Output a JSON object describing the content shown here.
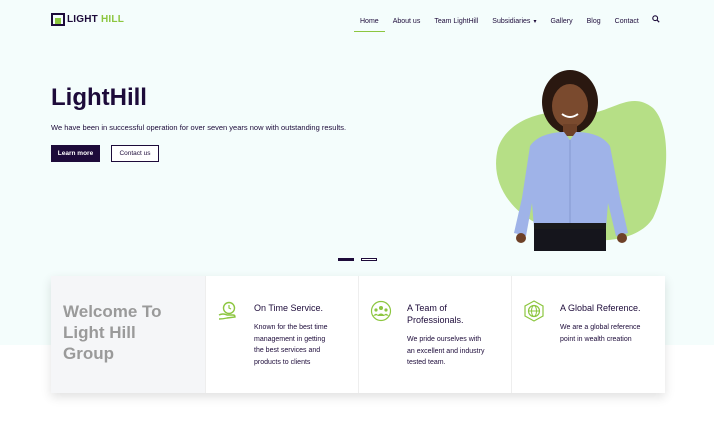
{
  "brand": {
    "logo_light": "LIGHT",
    "logo_hill": "HILL",
    "accent_green": "#8cc63f",
    "brand_navy": "#1d0b3a"
  },
  "nav": {
    "items": [
      {
        "label": "Home",
        "active": true
      },
      {
        "label": "About us"
      },
      {
        "label": "Team LightHill"
      },
      {
        "label": "Subsidiaries",
        "caret": "▾"
      },
      {
        "label": "Gallery"
      },
      {
        "label": "Blog"
      },
      {
        "label": "Contact"
      }
    ],
    "search_icon": "search-icon"
  },
  "hero": {
    "title": "LightHill",
    "subtitle": "We have been in successful operation for over seven years now with outstanding results.",
    "primary_button": "Learn more",
    "secondary_button": "Contact us",
    "slides": 2,
    "active_slide": 1
  },
  "features": {
    "welcome_lines": [
      "Welcome To",
      "Light Hill",
      "Group"
    ],
    "items": [
      {
        "icon": "hand-clock-icon",
        "title": "On Time Service.",
        "text": [
          "Known for the best time",
          "management in getting",
          "the best services and",
          "products to clients"
        ]
      },
      {
        "icon": "team-icon",
        "title": [
          "A Team of",
          "Professionals."
        ],
        "text": [
          "We pride ourselves with",
          "an excellent and industry",
          "tested team."
        ]
      },
      {
        "icon": "globe-icon",
        "title": "A Global Reference.",
        "text": [
          "We are a global reference",
          "point in wealth creation"
        ]
      }
    ]
  }
}
